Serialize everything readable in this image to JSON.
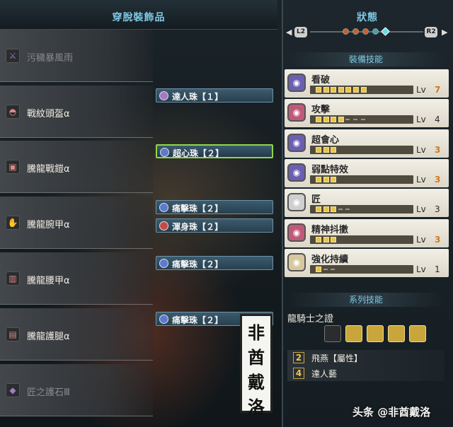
{
  "left_panel": {
    "title": "穿脫裝飾品",
    "equipment": [
      {
        "name": "污穢暴風雨",
        "icon": "weapon-icon",
        "dim": true
      },
      {
        "name": "戰紋頭盔α",
        "icon": "helmet-icon",
        "dim": false
      },
      {
        "name": "騰龍戰鎧α",
        "icon": "chest-armor-icon",
        "dim": false
      },
      {
        "name": "騰龍腕甲α",
        "icon": "arm-armor-icon",
        "dim": false
      },
      {
        "name": "騰龍腰甲α",
        "icon": "waist-armor-icon",
        "dim": false
      },
      {
        "name": "騰龍護腿α",
        "icon": "leg-armor-icon",
        "dim": false
      },
      {
        "name": "匠之護石Ⅲ",
        "icon": "charm-icon",
        "dim": true
      }
    ],
    "decorations": [
      {
        "label": "達人珠【１】",
        "color": "purple",
        "selected": false
      },
      {
        "label": "超心珠【２】",
        "color": "blue",
        "selected": true
      },
      {
        "label": "痛擊珠【２】",
        "color": "blue",
        "selected": false
      },
      {
        "label": "渾身珠【２】",
        "color": "red",
        "selected": false
      },
      {
        "label": "痛擊珠【２】",
        "color": "blue",
        "selected": false
      },
      {
        "label": "痛擊珠【２】",
        "color": "blue",
        "selected": false
      }
    ],
    "watermark_chars": [
      "非",
      "酋",
      "戴",
      "洛"
    ]
  },
  "right_panel": {
    "title": "狀態",
    "nav_left": "L2",
    "nav_right": "R2",
    "equip_skills_label": "裝備技能",
    "skills": [
      {
        "name": "看破",
        "icon": "eye-skill-icon",
        "color": "#6a5fb0",
        "level": 7,
        "max": 7,
        "lv_label": "Lv",
        "highlight": true
      },
      {
        "name": "攻擊",
        "icon": "attack-skill-icon",
        "color": "#c05a7a",
        "level": 4,
        "max": 7,
        "lv_label": "Lv",
        "highlight": false
      },
      {
        "name": "超會心",
        "icon": "crit-boost-icon",
        "color": "#6a5fb0",
        "level": 3,
        "max": 3,
        "lv_label": "Lv",
        "highlight": true
      },
      {
        "name": "弱點特效",
        "icon": "weakness-icon",
        "color": "#6a5fb0",
        "level": 3,
        "max": 3,
        "lv_label": "Lv",
        "highlight": true
      },
      {
        "name": "匠",
        "icon": "handicraft-icon",
        "color": "#cfcfcf",
        "level": 3,
        "max": 5,
        "lv_label": "Lv",
        "highlight": false
      },
      {
        "name": "精神抖擻",
        "icon": "maximum-might-icon",
        "color": "#c05a7a",
        "level": 3,
        "max": 3,
        "lv_label": "Lv",
        "highlight": true
      },
      {
        "name": "強化持續",
        "icon": "focus-icon",
        "color": "#d8c8a0",
        "level": 1,
        "max": 3,
        "lv_label": "Lv",
        "highlight": false
      }
    ],
    "set_skills_label": "系列技能",
    "set_name": "龍騎士之證",
    "set_pieces_on": 4,
    "set_pieces_total": 5,
    "set_bonuses": [
      {
        "count": "2",
        "text": "飛燕【屬性】"
      },
      {
        "count": "4",
        "text": "達人藝"
      }
    ]
  },
  "footer_watermark": "头条 @非酋戴洛"
}
